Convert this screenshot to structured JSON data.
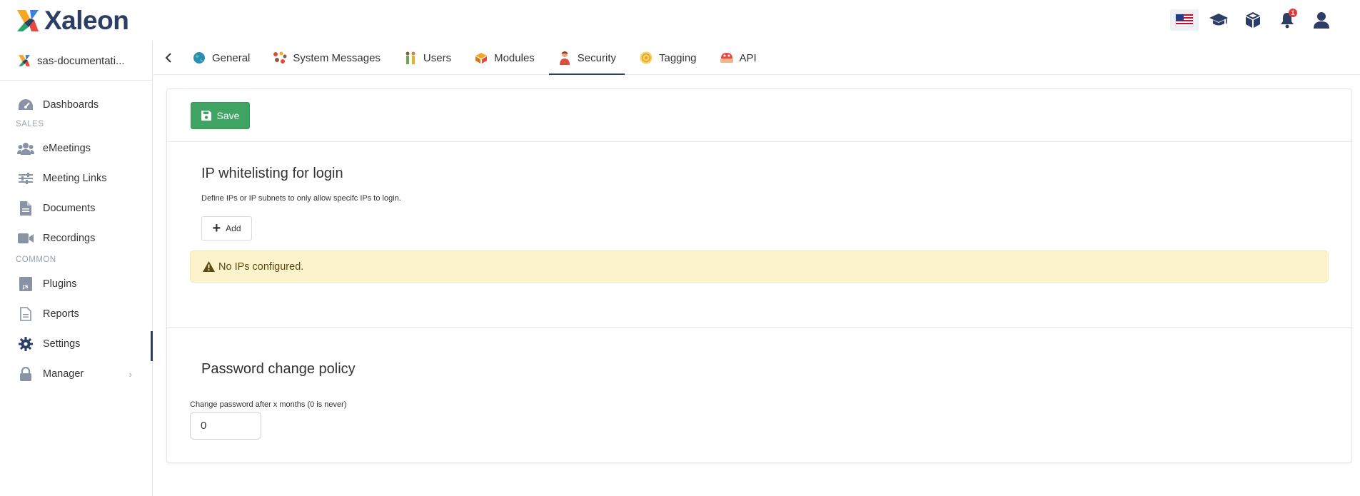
{
  "brand": {
    "name": "Xaleon"
  },
  "header": {
    "icons": [
      "flag-us-icon",
      "graduation-cap-icon",
      "cube-icon",
      "bell-icon",
      "user-icon"
    ],
    "notification_count": "1"
  },
  "sidebar": {
    "org_name": "sas-documentati...",
    "dashboards": "Dashboards",
    "sales_label": "SALES",
    "sales_items": [
      "eMeetings",
      "Meeting Links",
      "Documents",
      "Recordings"
    ],
    "common_label": "COMMON",
    "common_items": [
      "Plugins",
      "Reports",
      "Settings",
      "Manager"
    ],
    "active_item": "Settings"
  },
  "tabs": {
    "items": [
      "General",
      "System Messages",
      "Users",
      "Modules",
      "Security",
      "Tagging",
      "API"
    ],
    "active": "Security"
  },
  "toolbar": {
    "save_label": "Save"
  },
  "ip_section": {
    "title": "IP whitelisting for login",
    "description": "Define IPs or IP subnets to only allow specifc IPs to login.",
    "add_label": "Add",
    "alert_text": "No IPs configured."
  },
  "password_section": {
    "title": "Password change policy",
    "field_label": "Change password after x months (0 is never)",
    "field_value": "0"
  },
  "colors": {
    "brand_navy": "#2c3e66",
    "save_green": "#3fa462",
    "alert_bg": "#fcf3cd",
    "badge_red": "#e53935"
  }
}
